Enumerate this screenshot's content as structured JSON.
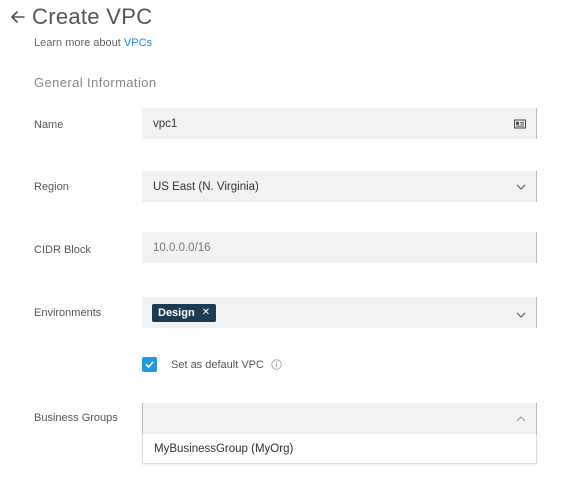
{
  "header": {
    "title": "Create VPC"
  },
  "learn_more": {
    "prefix": "Learn more about ",
    "link": "VPCs"
  },
  "section": {
    "general_information": "General Information"
  },
  "form": {
    "name": {
      "label": "Name",
      "value": "vpc1"
    },
    "region": {
      "label": "Region",
      "value": "US East (N. Virginia)"
    },
    "cidr_block": {
      "label": "CIDR Block",
      "value": "10.0.0.0/16"
    },
    "environments": {
      "label": "Environments",
      "chips": [
        "Design"
      ]
    },
    "default_vpc": {
      "label": "Set as default VPC",
      "checked": true
    },
    "business_groups": {
      "label": "Business Groups",
      "value": "",
      "options": [
        "MyBusinessGroup (MyOrg)"
      ]
    }
  },
  "colors": {
    "accent": "#1f8dd6",
    "checkbox": "#1f9bd6",
    "chip": "#1e3b54",
    "field_bg": "#f1f2f3"
  },
  "icons": {
    "back": "arrow-left-icon",
    "name_field": "id-card-icon",
    "dropdown": "chevron-down-icon",
    "dropdown_open": "chevron-up-icon",
    "info": "info-icon"
  }
}
